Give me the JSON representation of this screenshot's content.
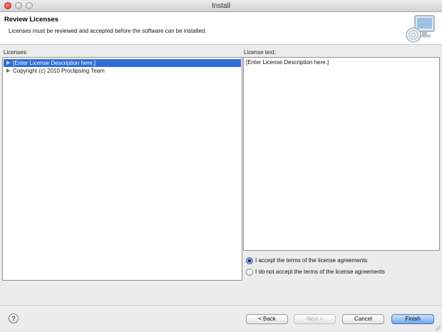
{
  "window": {
    "title": "Install"
  },
  "header": {
    "title": "Review Licenses",
    "description": "Licenses must be reviewed and accepted before the software can be installed."
  },
  "licenses": {
    "label": "Licenses:",
    "items": [
      {
        "label": "[Enter License Description here.]",
        "selected": true
      },
      {
        "label": "Copyright (c) 2010 Proclipsing Team",
        "selected": false
      }
    ]
  },
  "license_text": {
    "label": "License text:",
    "content": "[Enter License Description here.]"
  },
  "terms": {
    "accept_label": "I accept the terms of the license agreements",
    "decline_label": "I do not accept the terms of the license agreements",
    "selected": "accept"
  },
  "footer": {
    "help_label": "?",
    "back_label": "< Back",
    "next_label": "Next >",
    "cancel_label": "Cancel",
    "finish_label": "Finish"
  },
  "colors": {
    "selection": "#2f6cd6",
    "primary_button": "#6fa8ec"
  },
  "icons": {
    "banner": "install-cd-monitor-icon",
    "tree_expand": "triangle-right-icon",
    "help": "help-icon"
  }
}
